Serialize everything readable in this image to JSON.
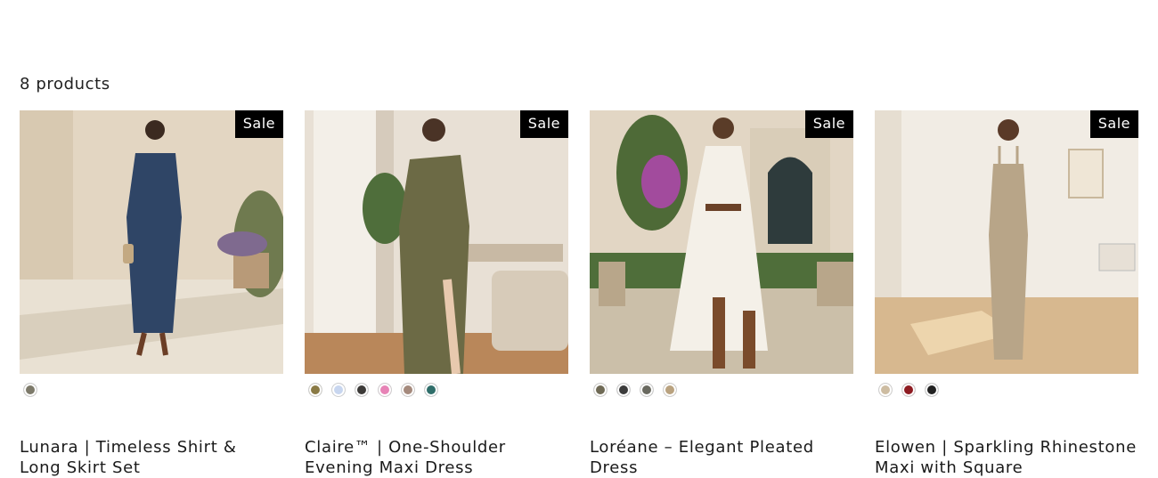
{
  "collection": {
    "product_count": "8 products"
  },
  "products": [
    {
      "title": "Lunara | Timeless Shirt & Long Skirt Set",
      "badge": "Sale",
      "swatches": [
        "#7d7a6a"
      ]
    },
    {
      "title": "Claire™ | One-Shoulder Evening Maxi Dress",
      "badge": "Sale",
      "swatches": [
        "#8a7a45",
        "#c8d6ef",
        "#3c3a38",
        "#e783b6",
        "#a58a7d",
        "#2f6e6a"
      ]
    },
    {
      "title": "Loréane – Elegant Pleated Dress",
      "badge": "Sale",
      "swatches": [
        "#6f6a55",
        "#3b3b3b",
        "#6a6a60",
        "#b9a27f"
      ]
    },
    {
      "title": "Elowen | Sparkling Rhinestone Maxi with Square",
      "badge": "Sale",
      "swatches": [
        "#cdbca1",
        "#8e1c22",
        "#222222"
      ]
    }
  ]
}
